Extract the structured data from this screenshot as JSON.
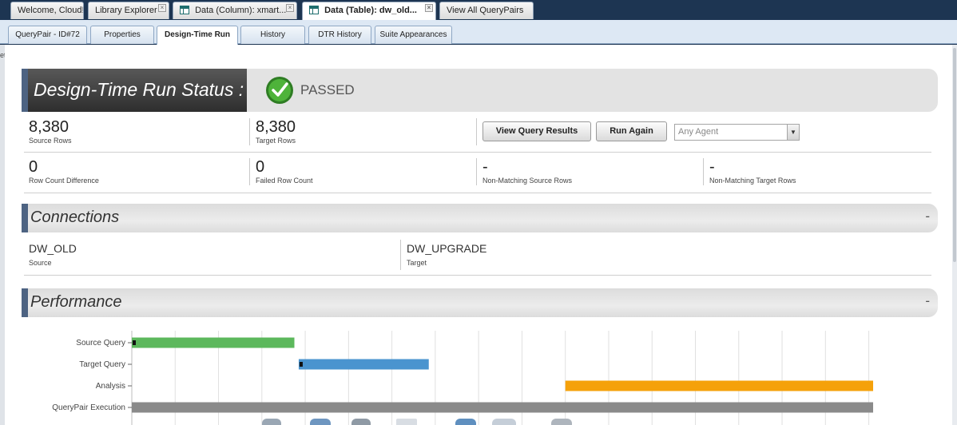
{
  "top_tabs": [
    {
      "label": "Welcome, Cloud!",
      "has_grid_icon": false,
      "active": false
    },
    {
      "label": "Library Explorer",
      "has_grid_icon": false,
      "active": false
    },
    {
      "label": "Data (Column): xmart...",
      "has_grid_icon": true,
      "active": false
    },
    {
      "label": "Data (Table): dw_old...",
      "has_grid_icon": true,
      "active": true
    },
    {
      "label": "View All QueryPairs",
      "has_grid_icon": false,
      "active": false
    }
  ],
  "close_glyph": "×",
  "sub_tabs": [
    {
      "label": "QueryPair - ID#72",
      "active": false
    },
    {
      "label": "Properties",
      "active": false
    },
    {
      "label": "Design-Time Run",
      "active": true
    },
    {
      "label": "History",
      "active": false
    },
    {
      "label": "DTR History",
      "active": false
    },
    {
      "label": "Suite Appearances",
      "active": false
    }
  ],
  "gutter_text": "et",
  "status": {
    "title": "Design-Time Run Status :",
    "value": "PASSED",
    "icon": "check-circle-icon",
    "icon_color": "#3a9a2a"
  },
  "metrics": {
    "source_rows": {
      "value": "8,380",
      "label": "Source Rows"
    },
    "target_rows": {
      "value": "8,380",
      "label": "Target Rows"
    },
    "row_count_difference": {
      "value": "0",
      "label": "Row Count Difference"
    },
    "failed_row_count": {
      "value": "0",
      "label": "Failed Row Count"
    },
    "non_matching_source_rows": {
      "value": "-",
      "label": "Non-Matching Source Rows"
    },
    "non_matching_target_rows": {
      "value": "-",
      "label": "Non-Matching Target Rows"
    }
  },
  "actions": {
    "view_query_results": "View Query Results",
    "run_again": "Run Again",
    "agent_select": {
      "selected": "Any Agent"
    }
  },
  "sections": {
    "connections": {
      "title": "Connections",
      "collapse": "-"
    },
    "performance": {
      "title": "Performance",
      "collapse": "-"
    }
  },
  "connections": {
    "source": {
      "name": "DW_OLD",
      "role": "Source"
    },
    "target": {
      "name": "DW_UPGRADE",
      "role": "Target"
    }
  },
  "chart_data": {
    "type": "bar",
    "orientation": "horizontal",
    "subtype": "gantt",
    "categories": [
      "Source Query",
      "Target Query",
      "Analysis",
      "QueryPair Execution"
    ],
    "series": [
      {
        "values": [
          [
            0,
            3.75
          ],
          [
            3.85,
            6.85
          ],
          [
            10,
            17.1
          ],
          [
            0,
            17.1
          ]
        ]
      }
    ],
    "colors": [
      "#5cb85c",
      "#4a94cf",
      "#f5a10a",
      "#8a8a8a"
    ],
    "xlim": [
      0,
      17.8
    ],
    "grid": true,
    "legend": "none",
    "title": "",
    "xlabel": "",
    "ylabel": ""
  }
}
